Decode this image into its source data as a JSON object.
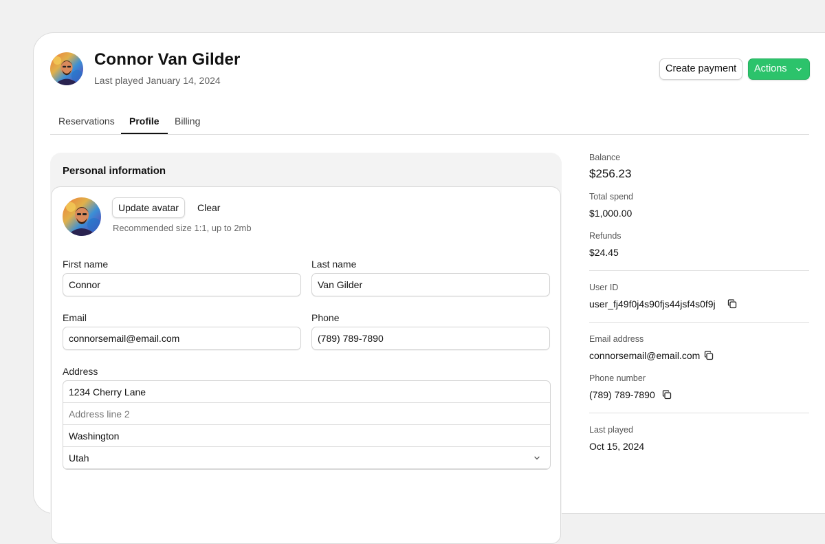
{
  "header": {
    "name": "Connor Van Gilder",
    "last_played": "Last played January 14, 2024",
    "create_payment_label": "Create payment",
    "actions_label": "Actions"
  },
  "tabs": [
    {
      "label": "Reservations"
    },
    {
      "label": "Profile",
      "active": true
    },
    {
      "label": "Billing"
    }
  ],
  "personal": {
    "title": "Personal information",
    "update_avatar_label": "Update avatar",
    "clear_label": "Clear",
    "recommended": "Recommended size 1:1, up to 2mb",
    "first_name_label": "First name",
    "first_name": "Connor",
    "last_name_label": "Last name",
    "last_name": "Van Gilder",
    "email_label": "Email",
    "email": "connorsemail@email.com",
    "phone_label": "Phone",
    "phone": "(789) 789-7890",
    "address_label": "Address",
    "address_line1": "1234 Cherry Lane",
    "address_line2_placeholder": "Address line 2",
    "city": "Washington",
    "state": "Utah"
  },
  "sidebar": {
    "balance_label": "Balance",
    "balance": "$256.23",
    "total_spend_label": "Total spend",
    "total_spend": "$1,000.00",
    "refunds_label": "Refunds",
    "refunds": "$24.45",
    "user_id_label": "User ID",
    "user_id": "user_fj49f0j4s90fjs44jsf4s0f9j",
    "email_label": "Email address",
    "email": "connorsemail@email.com",
    "phone_label": "Phone number",
    "phone": "(789) 789-7890",
    "last_played_label": "Last played",
    "last_played": "Oct 15, 2024"
  },
  "colors": {
    "accent": "#2cc36b",
    "background": "#f1f1f1"
  }
}
